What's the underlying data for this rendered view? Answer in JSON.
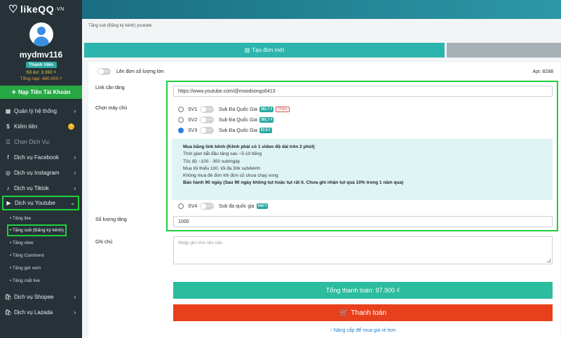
{
  "brand": {
    "name": "likeQQ",
    "suffix": "·VN"
  },
  "user": {
    "name": "mydmv116",
    "role": "Thành Viên",
    "balance": "Số dư: 3.392 ₫",
    "total_topup": "Tổng nạp: 480.000 ₫"
  },
  "sidebar": {
    "topup_label": "Nạp Tiền Tài Khoản",
    "items": [
      {
        "label": "Quản lý hệ thống",
        "icon": "grid-icon"
      },
      {
        "label": "Kiếm tiền",
        "icon": "dollar-icon"
      }
    ],
    "section_header": "Chọn Dịch Vụ:",
    "services": [
      {
        "label": "Dịch vụ Facebook",
        "icon": "f"
      },
      {
        "label": "Dịch vụ Instagram",
        "icon": "◎"
      },
      {
        "label": "Dịch vụ Tiktok",
        "icon": "♪"
      },
      {
        "label": "Dịch vụ Youtube",
        "icon": "▶"
      }
    ],
    "youtube_sub": [
      "• Tăng like",
      "• Tăng sub (Đăng ký kênh)",
      "• Tăng view",
      "• Tăng Comment",
      "• Tăng giờ xem",
      "• Tăng mắt live"
    ],
    "services_after": [
      {
        "label": "Dịch vụ Shopee",
        "icon": "🛍"
      },
      {
        "label": "Dịch vụ Lazada",
        "icon": "🛍"
      }
    ]
  },
  "breadcrumb": "Tăng sub (Đăng ký kênh) youtube",
  "tabs": {
    "create_label": "Tạo đơn mới"
  },
  "form": {
    "bulk_label": "Lên đơn số lượng lớn",
    "toggle_off": "OFF",
    "api": "Api: 8288",
    "link_label": "Link cần tăng",
    "link_value": "https://www.youtube.com/@moodsongs6413",
    "server_label": "Chọn máy chủ",
    "servers": [
      {
        "code": "SV1",
        "name": "Sub Đa Quốc Gia",
        "price": "391.7 ₫",
        "note": "Chậm",
        "checked": false
      },
      {
        "code": "SV2",
        "name": "Sub Đa Quốc Gia",
        "price": "391.7 ₫",
        "note": "",
        "checked": false
      },
      {
        "code": "SV3",
        "name": "Sub Đa Quốc Gia",
        "price": "97.9 ₫",
        "note": "",
        "checked": true
      },
      {
        "code": "SV4",
        "name": "Sub đa quốc gia",
        "price": "544 ₫",
        "note": "",
        "checked": false
      }
    ],
    "info_lines": [
      {
        "text": "Mua bằng link kênh  (Kênh phải có 1 video độ dài trên 2 phút)",
        "bold": true
      },
      {
        "text": "Thời gian bắt đầu tăng sau ~5-10 tiếng",
        "bold": false
      },
      {
        "text": "Tốc độ ~100 - 300 sub/ngày",
        "bold": false
      },
      {
        "text": "Mua tối thiểu 100, tối đa 30k sub/kênh",
        "bold": false
      },
      {
        "text": "Không mua đè đơn khi đơn cũ chưa chạy xong",
        "bold": false
      },
      {
        "text": "Bảo hành 90 ngày (Sau 90 ngày không tụt hoặc tụt rất ít. Chưa ghi nhận tụt quá 10% trong 1 năm qua)",
        "bold": true
      }
    ],
    "quantity_label": "Số lượng tăng",
    "quantity_value": "1000",
    "note_label": "Ghi chú",
    "note_placeholder": "Nhập ghi chú nếu cần",
    "total": "Tổng thanh toán: 97.900  ₫",
    "pay_label": "Thanh toán",
    "upgrade": "Nâng cấp để mua giá rẻ hơn"
  },
  "colors": {
    "sidebar_bg": "#263238",
    "topbar": "#2c98a7",
    "accent_teal": "#2cb5ad",
    "total_green": "#2bbd9d",
    "pay_red": "#e8401c",
    "highlight_green": "#1fcf3a"
  }
}
